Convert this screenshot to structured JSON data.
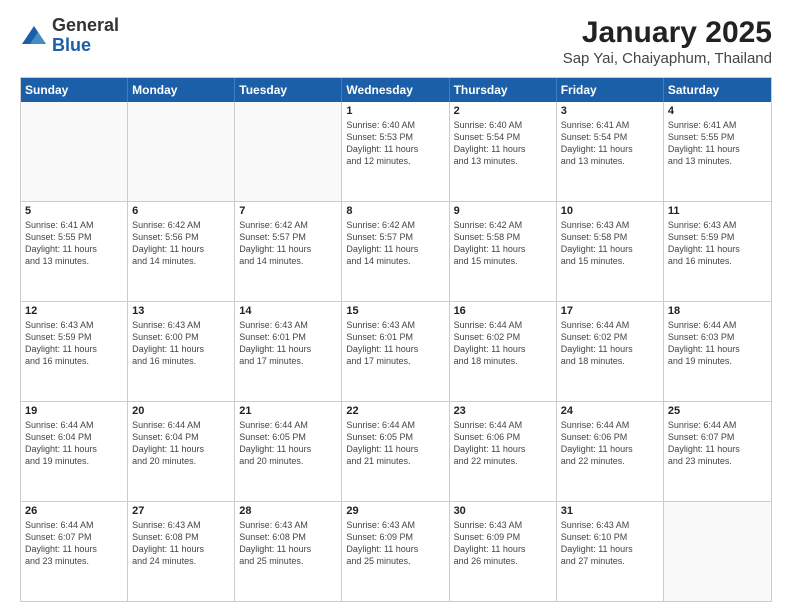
{
  "logo": {
    "general": "General",
    "blue": "Blue"
  },
  "header": {
    "title": "January 2025",
    "subtitle": "Sap Yai, Chaiyaphum, Thailand"
  },
  "dayHeaders": [
    "Sunday",
    "Monday",
    "Tuesday",
    "Wednesday",
    "Thursday",
    "Friday",
    "Saturday"
  ],
  "weeks": [
    [
      {
        "day": "",
        "info": ""
      },
      {
        "day": "",
        "info": ""
      },
      {
        "day": "",
        "info": ""
      },
      {
        "day": "1",
        "info": "Sunrise: 6:40 AM\nSunset: 5:53 PM\nDaylight: 11 hours\nand 12 minutes."
      },
      {
        "day": "2",
        "info": "Sunrise: 6:40 AM\nSunset: 5:54 PM\nDaylight: 11 hours\nand 13 minutes."
      },
      {
        "day": "3",
        "info": "Sunrise: 6:41 AM\nSunset: 5:54 PM\nDaylight: 11 hours\nand 13 minutes."
      },
      {
        "day": "4",
        "info": "Sunrise: 6:41 AM\nSunset: 5:55 PM\nDaylight: 11 hours\nand 13 minutes."
      }
    ],
    [
      {
        "day": "5",
        "info": "Sunrise: 6:41 AM\nSunset: 5:55 PM\nDaylight: 11 hours\nand 13 minutes."
      },
      {
        "day": "6",
        "info": "Sunrise: 6:42 AM\nSunset: 5:56 PM\nDaylight: 11 hours\nand 14 minutes."
      },
      {
        "day": "7",
        "info": "Sunrise: 6:42 AM\nSunset: 5:57 PM\nDaylight: 11 hours\nand 14 minutes."
      },
      {
        "day": "8",
        "info": "Sunrise: 6:42 AM\nSunset: 5:57 PM\nDaylight: 11 hours\nand 14 minutes."
      },
      {
        "day": "9",
        "info": "Sunrise: 6:42 AM\nSunset: 5:58 PM\nDaylight: 11 hours\nand 15 minutes."
      },
      {
        "day": "10",
        "info": "Sunrise: 6:43 AM\nSunset: 5:58 PM\nDaylight: 11 hours\nand 15 minutes."
      },
      {
        "day": "11",
        "info": "Sunrise: 6:43 AM\nSunset: 5:59 PM\nDaylight: 11 hours\nand 16 minutes."
      }
    ],
    [
      {
        "day": "12",
        "info": "Sunrise: 6:43 AM\nSunset: 5:59 PM\nDaylight: 11 hours\nand 16 minutes."
      },
      {
        "day": "13",
        "info": "Sunrise: 6:43 AM\nSunset: 6:00 PM\nDaylight: 11 hours\nand 16 minutes."
      },
      {
        "day": "14",
        "info": "Sunrise: 6:43 AM\nSunset: 6:01 PM\nDaylight: 11 hours\nand 17 minutes."
      },
      {
        "day": "15",
        "info": "Sunrise: 6:43 AM\nSunset: 6:01 PM\nDaylight: 11 hours\nand 17 minutes."
      },
      {
        "day": "16",
        "info": "Sunrise: 6:44 AM\nSunset: 6:02 PM\nDaylight: 11 hours\nand 18 minutes."
      },
      {
        "day": "17",
        "info": "Sunrise: 6:44 AM\nSunset: 6:02 PM\nDaylight: 11 hours\nand 18 minutes."
      },
      {
        "day": "18",
        "info": "Sunrise: 6:44 AM\nSunset: 6:03 PM\nDaylight: 11 hours\nand 19 minutes."
      }
    ],
    [
      {
        "day": "19",
        "info": "Sunrise: 6:44 AM\nSunset: 6:04 PM\nDaylight: 11 hours\nand 19 minutes."
      },
      {
        "day": "20",
        "info": "Sunrise: 6:44 AM\nSunset: 6:04 PM\nDaylight: 11 hours\nand 20 minutes."
      },
      {
        "day": "21",
        "info": "Sunrise: 6:44 AM\nSunset: 6:05 PM\nDaylight: 11 hours\nand 20 minutes."
      },
      {
        "day": "22",
        "info": "Sunrise: 6:44 AM\nSunset: 6:05 PM\nDaylight: 11 hours\nand 21 minutes."
      },
      {
        "day": "23",
        "info": "Sunrise: 6:44 AM\nSunset: 6:06 PM\nDaylight: 11 hours\nand 22 minutes."
      },
      {
        "day": "24",
        "info": "Sunrise: 6:44 AM\nSunset: 6:06 PM\nDaylight: 11 hours\nand 22 minutes."
      },
      {
        "day": "25",
        "info": "Sunrise: 6:44 AM\nSunset: 6:07 PM\nDaylight: 11 hours\nand 23 minutes."
      }
    ],
    [
      {
        "day": "26",
        "info": "Sunrise: 6:44 AM\nSunset: 6:07 PM\nDaylight: 11 hours\nand 23 minutes."
      },
      {
        "day": "27",
        "info": "Sunrise: 6:43 AM\nSunset: 6:08 PM\nDaylight: 11 hours\nand 24 minutes."
      },
      {
        "day": "28",
        "info": "Sunrise: 6:43 AM\nSunset: 6:08 PM\nDaylight: 11 hours\nand 25 minutes."
      },
      {
        "day": "29",
        "info": "Sunrise: 6:43 AM\nSunset: 6:09 PM\nDaylight: 11 hours\nand 25 minutes."
      },
      {
        "day": "30",
        "info": "Sunrise: 6:43 AM\nSunset: 6:09 PM\nDaylight: 11 hours\nand 26 minutes."
      },
      {
        "day": "31",
        "info": "Sunrise: 6:43 AM\nSunset: 6:10 PM\nDaylight: 11 hours\nand 27 minutes."
      },
      {
        "day": "",
        "info": ""
      }
    ]
  ]
}
